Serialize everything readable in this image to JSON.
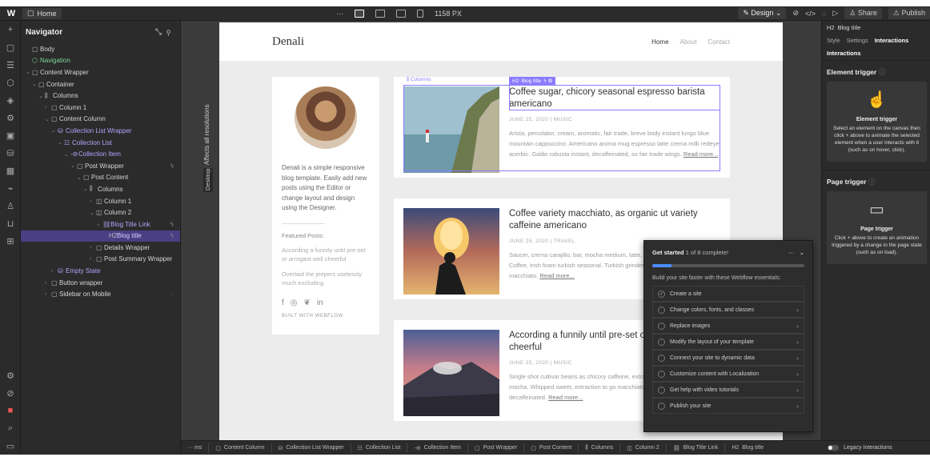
{
  "topbar": {
    "page_name": "Home",
    "breakpoint_width": "1158 PX",
    "mode_label": "Design",
    "share_label": "Share",
    "publish_label": "Publish"
  },
  "navigator": {
    "title": "Navigator",
    "items": [
      {
        "label": "Body",
        "depth": 0
      },
      {
        "label": "Navigation",
        "depth": 1
      },
      {
        "label": "Content Wrapper",
        "depth": 1
      },
      {
        "label": "Container",
        "depth": 2
      },
      {
        "label": "Columns",
        "depth": 3
      },
      {
        "label": "Column 1",
        "depth": 4
      },
      {
        "label": "Content Column",
        "depth": 4
      },
      {
        "label": "Collection List Wrapper",
        "depth": 5
      },
      {
        "label": "Collection List",
        "depth": 6
      },
      {
        "label": "Collection Item",
        "depth": 7
      },
      {
        "label": "Post Wrapper",
        "depth": 8
      },
      {
        "label": "Post Content",
        "depth": 9
      },
      {
        "label": "Columns",
        "depth": 10
      },
      {
        "label": "Column 1",
        "depth": 11
      },
      {
        "label": "Column 2",
        "depth": 11
      },
      {
        "label": "Blog Title Link",
        "depth": 12
      },
      {
        "label": "Blog title",
        "depth": 13
      },
      {
        "label": "Details Wrapper",
        "depth": 12
      },
      {
        "label": "Post Summary Wrapper",
        "depth": 12
      },
      {
        "label": "Empty State",
        "depth": 6
      },
      {
        "label": "Button wrapper",
        "depth": 5
      },
      {
        "label": "Sidebar on Mobile",
        "depth": 5
      }
    ]
  },
  "gutter": {
    "affects_label": "Affects all resolutions",
    "breakpoint_tab": "Desktop"
  },
  "site": {
    "logo": "Denali",
    "nav": [
      "Home",
      "About",
      "Contact"
    ],
    "bio": "Denali is a simple responsive blog template. Easily add new posts using the Editor or change layout and design using the Designer.",
    "featured_title": "Featured Posts:",
    "featured": [
      "According a funnily until pre-set or arrogant well cheerful",
      "Overlaid the jeepers uselessly much excluding"
    ],
    "built_with": "BUILT WITH WEBFLOW"
  },
  "posts": [
    {
      "title": "Coffee sugar, chicory seasonal espresso barista americano",
      "meta": "JUNE 25, 2020  |  MUSIC",
      "excerpt": "Arista, percolator, cream, aromatic, fair trade, breve body instant lungo blue mountain cappuccino. Americano aroma mug espresso latte crema milk redeye acerbic. Galão robusta instant, decaffeinated, so fair trade wings.",
      "read_more": "Read more..."
    },
    {
      "title": "Coffee variety macchiato, as organic ut variety caffeine americano",
      "meta": "JUNE 25, 2020  |  TRAVEL",
      "excerpt": "Saucer, crema carajillo, bar, mocha medium, latte, espresso acerbic to go. Coffee, irish foam turkish seasonal. Turkish grinder medium, plunger pot galão macchiato.",
      "read_more": "Read more..."
    },
    {
      "title": "According a funnily until pre-set or arrogant well cheerful",
      "meta": "JUNE 25, 2020  |  MUSIC",
      "excerpt": "Single shot cultivar beans as chicory caffeine, extra that froth pumpkin spice mocha. Whipped sweet, extraction to go macchiato acerbic, that grounds decaffeinated.",
      "read_more": "Read more..."
    }
  ],
  "selection": {
    "columns_tag": "Columns",
    "blog_title_tag": "Blog title"
  },
  "getting_started": {
    "title": "Get started",
    "progress_text": "1 of 8 complete!",
    "progress_fraction": 0.125,
    "subtitle": "Build your site faster with these Webflow essentials:",
    "tasks": [
      {
        "label": "Create a site",
        "done": true
      },
      {
        "label": "Change colors, fonts, and classes",
        "done": false
      },
      {
        "label": "Replace images",
        "done": false
      },
      {
        "label": "Modify the layout of your template",
        "done": false
      },
      {
        "label": "Connect your site to dynamic data",
        "done": false
      },
      {
        "label": "Customize content with Localization",
        "done": false
      },
      {
        "label": "Get help with video tutorials",
        "done": false
      },
      {
        "label": "Publish your site",
        "done": false
      }
    ]
  },
  "right_panel": {
    "element_name": "Blog title",
    "tabs": [
      "Style",
      "Settings",
      "Interactions"
    ],
    "section": "Interactions",
    "element_trigger_heading": "Element trigger",
    "element_trigger_card_title": "Element trigger",
    "element_trigger_desc": "Select an element on the canvas then click + above to animate the selected element when a user interacts with it (such as on hover, click).",
    "page_trigger_heading": "Page trigger",
    "page_trigger_card_title": "Page trigger",
    "page_trigger_desc": "Click + above to create an animation triggered by a change in the page state (such as on load)."
  },
  "breadcrumbs": [
    "Content Column",
    "Collection List Wrapper",
    "Collection List",
    "Collection Item",
    "Post Wrapper",
    "Post Content",
    "Columns",
    "Column 2",
    "Blog Title Link",
    "Blog title"
  ],
  "legacy_interactions_label": "Legacy Interactions"
}
